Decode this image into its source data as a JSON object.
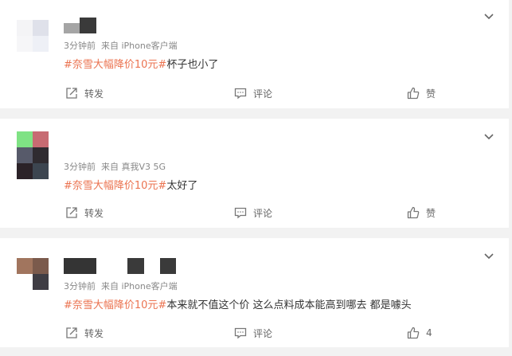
{
  "posts": [
    {
      "meta_time": "3分钟前",
      "meta_source": "来自 iPhone客户端",
      "topic": "#奈雪大幅降价10元#",
      "text": "杯子也小了",
      "repost_label": "转发",
      "comment_label": "评论",
      "like_label": "赞",
      "avatar_colors": [
        "#f4f4f6",
        "#dfe1ea",
        "#f6f6f8",
        "#eef0f6"
      ],
      "name_blocks": [
        "#a5a5a5",
        "#3a3a3a"
      ]
    },
    {
      "meta_time": "3分钟前",
      "meta_source": "来自 真我V3 5G",
      "topic": "#奈雪大幅降价10元#",
      "text": "太好了",
      "repost_label": "转发",
      "comment_label": "评论",
      "like_label": "赞",
      "avatar_colors": [
        "#7fe284",
        "#c76b72",
        "#575a6a",
        "#2f2b30",
        "#2b2228",
        "#3c4550"
      ],
      "name_blocks": []
    },
    {
      "meta_time": "3分钟前",
      "meta_source": "来自 iPhone客户端",
      "topic": "#奈雪大幅降价10元#",
      "text": "本来就不值这个价 这么点料成本能高到哪去 都是噱头",
      "repost_label": "转发",
      "comment_label": "评论",
      "like_label": "4",
      "avatar_colors": [
        "#a1755e",
        "#7b5a4c",
        "#ffffff",
        "#3f3d44"
      ],
      "name_blocks": [
        "#343434",
        "#3a3a3a",
        "#3a3a3a"
      ]
    }
  ]
}
